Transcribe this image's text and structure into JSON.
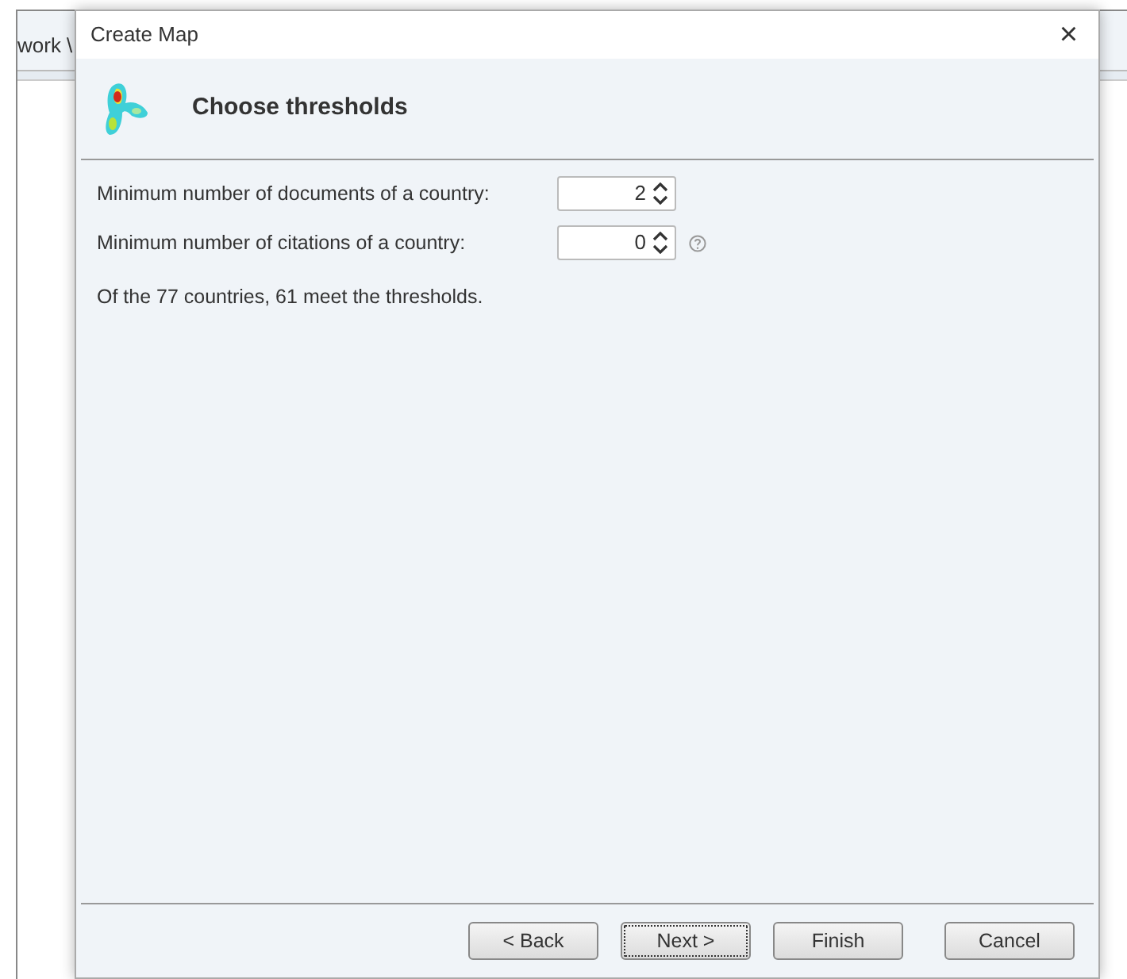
{
  "background_window": {
    "tab_label": "work \\"
  },
  "dialog": {
    "title": "Create Map",
    "close": "×"
  },
  "header": {
    "title": "Choose thresholds"
  },
  "fields": [
    {
      "label": "Minimum number of documents of a country:",
      "value": "2",
      "help": false
    },
    {
      "label": "Minimum number of citations of a country:",
      "value": "0",
      "help": true
    }
  ],
  "summary": "Of the 77 countries, 61 meet the thresholds.",
  "buttons": [
    {
      "label": "< Back",
      "focused": false
    },
    {
      "label": "Next >",
      "focused": true
    },
    {
      "label": "Finish",
      "focused": false
    },
    {
      "label": "Cancel",
      "focused": false
    }
  ]
}
